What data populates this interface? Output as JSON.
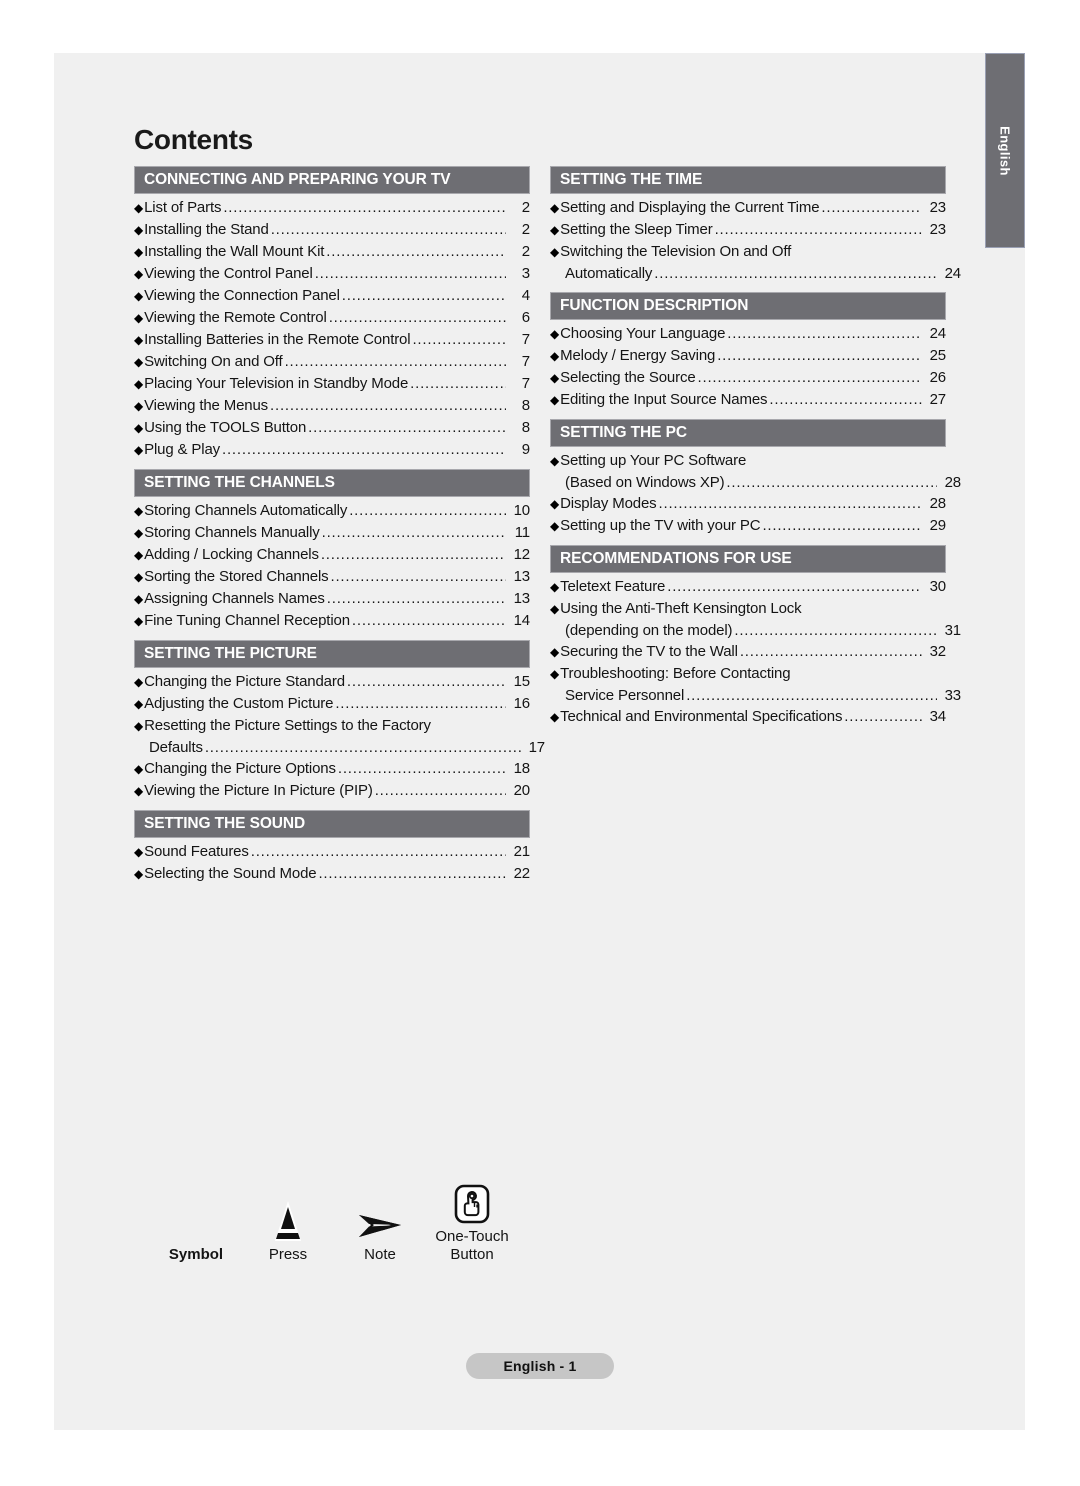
{
  "page": {
    "title": "Contents",
    "side_tab_label": "English",
    "footer_label": "English - 1",
    "header_bg": "#6e6e73",
    "sheet_bg": "#f0f0f0",
    "footer_pill_bg": "#c6c6c6"
  },
  "columns": [
    {
      "sections": [
        {
          "header": "CONNECTING AND PREPARING YOUR TV",
          "entries": [
            {
              "text": "List of Parts",
              "page": "2"
            },
            {
              "text": "Installing the Stand",
              "page": "2"
            },
            {
              "text": "Installing the Wall Mount Kit",
              "page": "2"
            },
            {
              "text": "Viewing the Control Panel",
              "page": "3"
            },
            {
              "text": "Viewing the Connection Panel",
              "page": "4"
            },
            {
              "text": "Viewing the Remote Control",
              "page": "6"
            },
            {
              "text": "Installing Batteries in the Remote Control",
              "page": "7"
            },
            {
              "text": "Switching On and Off",
              "page": "7"
            },
            {
              "text": "Placing Your Television in Standby Mode",
              "page": "7"
            },
            {
              "text": "Viewing the Menus",
              "page": "8"
            },
            {
              "text": "Using the TOOLS Button",
              "page": "8"
            },
            {
              "text": "Plug & Play",
              "page": "9"
            }
          ]
        },
        {
          "header": "SETTING THE CHANNELS",
          "entries": [
            {
              "text": "Storing Channels Automatically",
              "page": "10"
            },
            {
              "text": "Storing Channels Manually",
              "page": "11"
            },
            {
              "text": "Adding / Locking Channels",
              "page": "12"
            },
            {
              "text": "Sorting the Stored Channels",
              "page": "13"
            },
            {
              "text": "Assigning Channels Names",
              "page": "13"
            },
            {
              "text": "Fine Tuning Channel Reception",
              "page": "14"
            }
          ]
        },
        {
          "header": "SETTING THE PICTURE",
          "entries": [
            {
              "text": "Changing the Picture Standard",
              "page": "15"
            },
            {
              "text": "Adjusting the Custom Picture",
              "page": "16"
            },
            {
              "text": "Resetting the Picture Settings to the Factory",
              "page": "",
              "wrap": true
            },
            {
              "text": "Defaults",
              "page": "17",
              "cont": true
            },
            {
              "text": "Changing the Picture Options",
              "page": "18"
            },
            {
              "text": "Viewing the Picture In Picture (PIP)",
              "page": "20"
            }
          ]
        },
        {
          "header": "SETTING THE SOUND",
          "entries": [
            {
              "text": "Sound Features",
              "page": "21"
            },
            {
              "text": "Selecting the Sound Mode",
              "page": "22"
            }
          ]
        }
      ]
    },
    {
      "sections": [
        {
          "header": "SETTING THE TIME",
          "entries": [
            {
              "text": "Setting and Displaying the Current Time",
              "page": "23"
            },
            {
              "text": "Setting the Sleep Timer",
              "page": "23"
            },
            {
              "text": "Switching the Television On and Off",
              "page": "",
              "wrap": true
            },
            {
              "text": "Automatically",
              "page": "24",
              "cont": true
            }
          ]
        },
        {
          "header": "FUNCTION DESCRIPTION",
          "entries": [
            {
              "text": "Choosing Your Language",
              "page": "24"
            },
            {
              "text": "Melody / Energy Saving",
              "page": "25"
            },
            {
              "text": "Selecting the Source",
              "page": "26"
            },
            {
              "text": "Editing the Input Source Names",
              "page": "27"
            }
          ]
        },
        {
          "header": "SETTING THE PC",
          "entries": [
            {
              "text": "Setting up Your PC Software",
              "page": "",
              "wrap": true
            },
            {
              "text": "(Based on Windows XP)",
              "page": "28",
              "cont": true
            },
            {
              "text": "Display Modes",
              "page": "28"
            },
            {
              "text": "Setting up the TV with your PC",
              "page": "29"
            }
          ]
        },
        {
          "header": "RECOMMENDATIONS FOR USE",
          "entries": [
            {
              "text": "Teletext Feature",
              "page": "30"
            },
            {
              "text": "Using the Anti-Theft Kensington Lock",
              "page": "",
              "wrap": true
            },
            {
              "text": "(depending on the model)",
              "page": "31",
              "cont": true
            },
            {
              "text": "Securing the TV to the Wall",
              "page": "32"
            },
            {
              "text": "Troubleshooting: Before Contacting",
              "page": "",
              "wrap": true
            },
            {
              "text": "Service Personnel",
              "page": "33",
              "cont": true
            },
            {
              "text": "Technical and Environmental Specifications",
              "page": "34"
            }
          ]
        }
      ]
    }
  ],
  "legend": [
    {
      "label": "Symbol",
      "label2": "",
      "icon": "none",
      "bold": true
    },
    {
      "label": "Press",
      "label2": "",
      "icon": "press-triangle-icon",
      "bold": false
    },
    {
      "label": "Note",
      "label2": "",
      "icon": "note-arrow-icon",
      "bold": false
    },
    {
      "label": "One-Touch",
      "label2": "Button",
      "icon": "one-touch-button-icon",
      "bold": false
    }
  ]
}
